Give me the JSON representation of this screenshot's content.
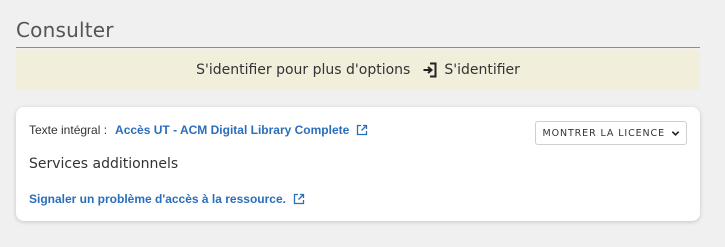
{
  "section": {
    "title": "Consulter"
  },
  "login_bar": {
    "text": "S'identifier pour plus d'options",
    "button_label": "S'identifier"
  },
  "card": {
    "fulltext_label": "Texte intégral :",
    "fulltext_link": "Accès UT - ACM Digital Library Complete",
    "license_button": "MONTRER LA LICENCE",
    "services_title": "Services additionnels",
    "report_link": "Signaler un problème d'accès à la ressource."
  },
  "colors": {
    "link": "#2a6ebb",
    "login_bar_bg": "#f2eedc",
    "page_bg": "#f0f0f0"
  },
  "icons": {
    "login": "sign-in-icon",
    "external": "external-link-icon",
    "chevron": "chevron-down-icon"
  }
}
